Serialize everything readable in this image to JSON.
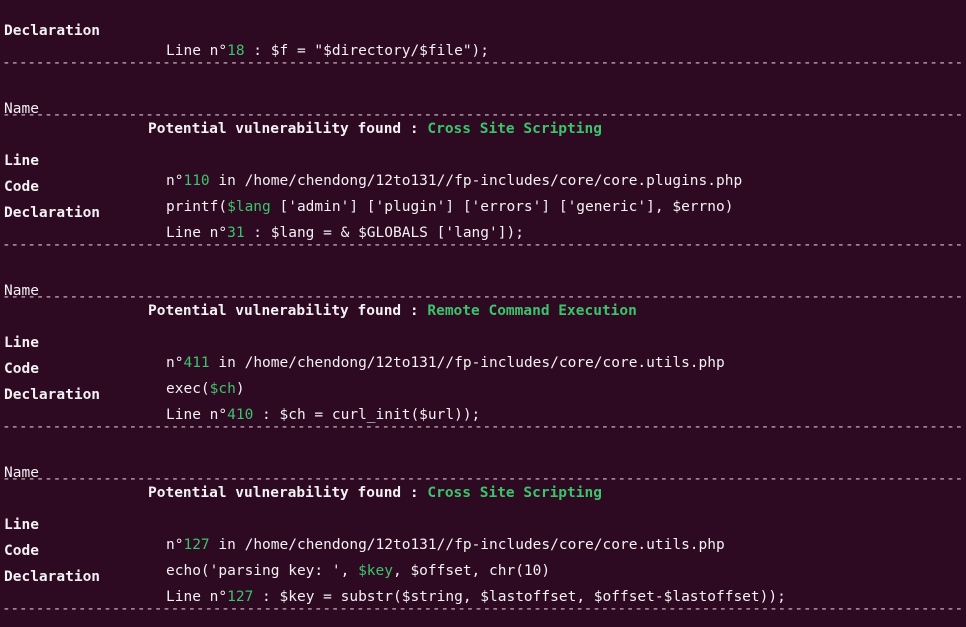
{
  "colors": {
    "background": "#2d0922",
    "text": "#f2f2f2",
    "highlight": "#3bc46b"
  },
  "separator": "-----------------------------------------------------------------------------------------------------------------------",
  "top": {
    "label": "Declaration",
    "prefix": "Line n°",
    "num": "18",
    "rest": " : $f = \"$directory/$file\");"
  },
  "blocks": [
    {
      "name_label": "Name",
      "title": "Potential vulnerability found : ",
      "type": "Cross Site Scripting",
      "line_label": "Line",
      "line_prefix": "n°",
      "line_num": "110",
      "line_rest": " in /home/chendong/12to131//fp-includes/core/core.plugins.php",
      "code_label": "Code",
      "code_pre": "printf(",
      "code_var": "$lang",
      "code_post": " ['admin'] ['plugin'] ['errors'] ['generic'], $errno)",
      "decl_label": "Declaration",
      "decl_prefix": "Line n°",
      "decl_num": "31",
      "decl_rest": " : $lang = & $GLOBALS ['lang']);"
    },
    {
      "name_label": "Name",
      "title": "Potential vulnerability found : ",
      "type": "Remote Command Execution",
      "line_label": "Line",
      "line_prefix": "n°",
      "line_num": "411",
      "line_rest": " in /home/chendong/12to131//fp-includes/core/core.utils.php",
      "code_label": "Code",
      "code_pre": "exec(",
      "code_var": "$ch",
      "code_post": ")",
      "decl_label": "Declaration",
      "decl_prefix": "Line n°",
      "decl_num": "410",
      "decl_rest": " : $ch = curl_init($url));"
    },
    {
      "name_label": "Name",
      "title": "Potential vulnerability found : ",
      "type": "Cross Site Scripting",
      "line_label": "Line",
      "line_prefix": "n°",
      "line_num": "127",
      "line_rest": " in /home/chendong/12to131//fp-includes/core/core.utils.php",
      "code_label": "Code",
      "code_pre": "echo('parsing key: ', ",
      "code_var": "$key",
      "code_post": ", $offset, chr(10)",
      "decl_label": "Declaration",
      "decl_prefix": "Line n°",
      "decl_num": "127",
      "decl_rest": " : $key = substr($string, $lastoffset, $offset-$lastoffset));"
    }
  ]
}
